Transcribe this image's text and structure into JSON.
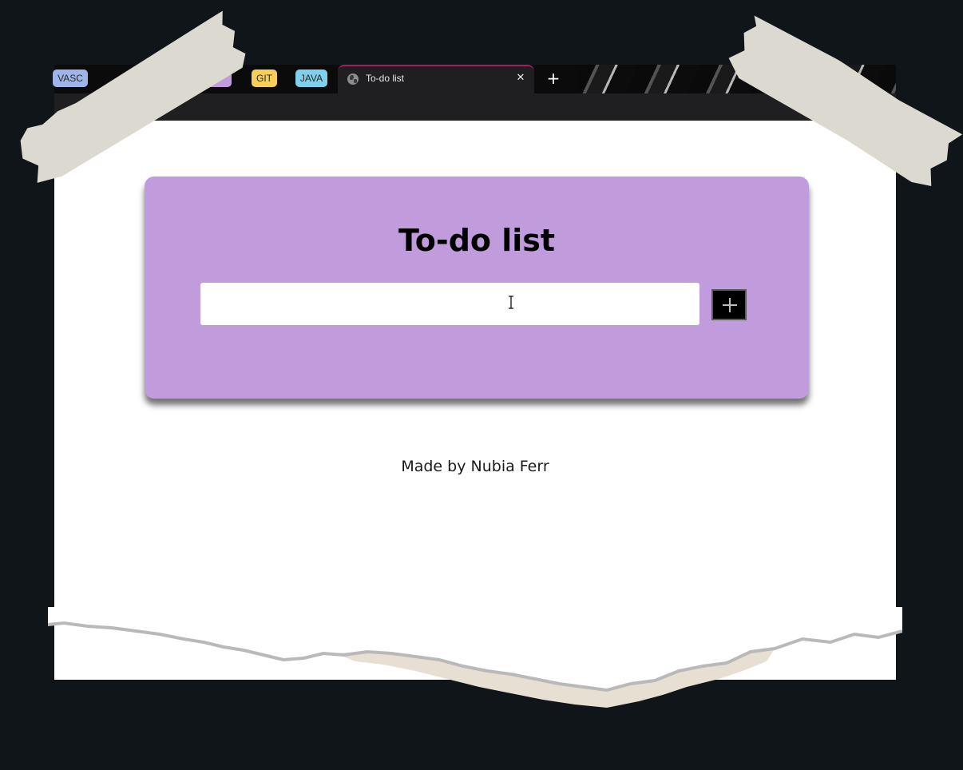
{
  "browser": {
    "tab_groups": [
      "VASC",
      "",
      "GIT",
      "JAVA"
    ],
    "active_tab": {
      "title": "To-do list",
      "close_glyph": "✕"
    },
    "new_tab_glyph": "+"
  },
  "page": {
    "title": "To-do list",
    "input": {
      "value": "",
      "placeholder": ""
    },
    "add_button_icon": "plus-icon",
    "credit": "Made by Nubia Ferr"
  },
  "colors": {
    "card_background": "#c09cdc",
    "background": "#10151a",
    "add_button": "#000000",
    "active_tab_accent": "#a1205a"
  }
}
